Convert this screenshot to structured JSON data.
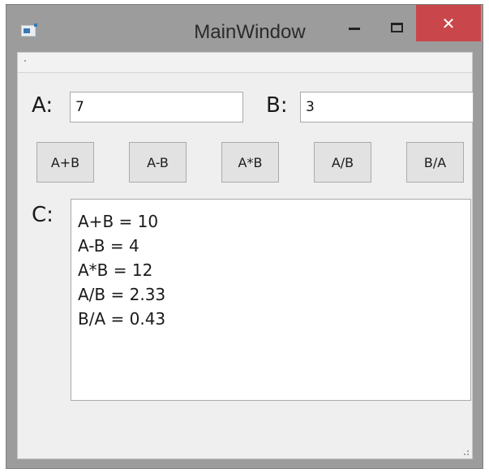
{
  "window": {
    "title": "MainWindow",
    "close_label": "✕"
  },
  "form": {
    "a_label": "A:",
    "a_value": "7",
    "b_label": "B:",
    "b_value": "3",
    "c_label": "C:"
  },
  "buttons": {
    "add": "A+B",
    "subtract": "A-B",
    "multiply": "A*B",
    "divide_ab": "A/B",
    "divide_ba": "B/A"
  },
  "output": {
    "lines": [
      "A+B = 10",
      "A-B = 4",
      "A*B = 12",
      "A/B = 2.33",
      "B/A = 0.43"
    ]
  },
  "colors": {
    "close_button": "#c9474a",
    "window_frame": "#9c9c9c",
    "client_bg": "#efefef"
  }
}
